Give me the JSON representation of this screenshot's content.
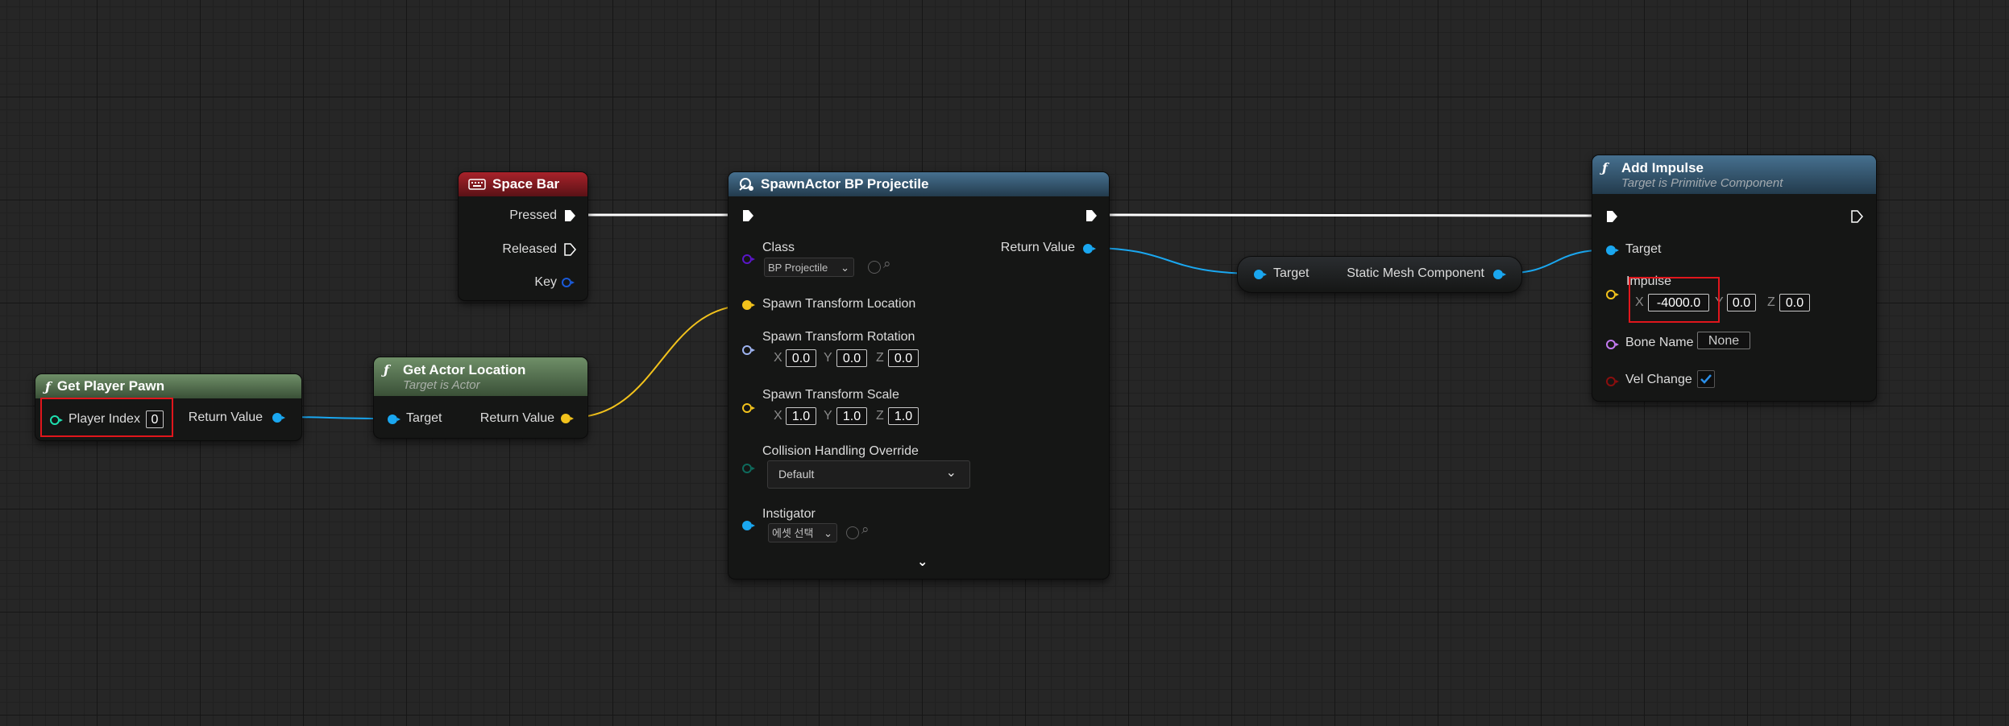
{
  "colors": {
    "exec": "#ffffff",
    "object_pin": "#1aa7f0",
    "vector_pin": "#f2c21c",
    "rotator_pin": "#9eb3f0",
    "class_pin": "#5a16c8",
    "enum_pin": "#0e6a5c",
    "name_pin": "#c37af0",
    "bool_pin": "#8a0e0e",
    "int_pin": "#1ee0b0",
    "highlight": "#e0161c"
  },
  "nodes": {
    "space_bar": {
      "title": "Space Bar",
      "icon": "keyboard-icon",
      "pressed": "Pressed",
      "released": "Released",
      "key": "Key"
    },
    "get_player_pawn": {
      "title": "Get Player Pawn",
      "icon": "function-icon",
      "player_index_label": "Player Index",
      "player_index_value": "0",
      "return_value": "Return Value"
    },
    "get_actor_location": {
      "title": "Get Actor Location",
      "subtitle": "Target is Actor",
      "target": "Target",
      "return_value": "Return Value"
    },
    "spawn_actor": {
      "title": "SpawnActor BP Projectile",
      "class_label": "Class",
      "class_value": "BP Projectile",
      "return_value": "Return Value",
      "spawn_location": "Spawn Transform Location",
      "spawn_rotation": "Spawn Transform Rotation",
      "rot_x": "0.0",
      "rot_y": "0.0",
      "rot_z": "0.0",
      "spawn_scale": "Spawn Transform Scale",
      "scale_x": "1.0",
      "scale_y": "1.0",
      "scale_z": "1.0",
      "collision_label": "Collision Handling Override",
      "collision_value": "Default",
      "instigator_label": "Instigator",
      "instigator_value": "에셋 선택"
    },
    "static_mesh": {
      "target": "Target",
      "output": "Static Mesh Component"
    },
    "add_impulse": {
      "title": "Add Impulse",
      "subtitle": "Target is Primitive Component",
      "target": "Target",
      "impulse_label": "Impulse",
      "impulse_x": "-4000.0",
      "impulse_y": "0.0",
      "impulse_z": "0.0",
      "bone_name_label": "Bone Name",
      "bone_name_value": "None",
      "vel_change_label": "Vel Change",
      "vel_change_checked": true
    }
  },
  "axis_labels": {
    "x": "X",
    "y": "Y",
    "z": "Z"
  }
}
